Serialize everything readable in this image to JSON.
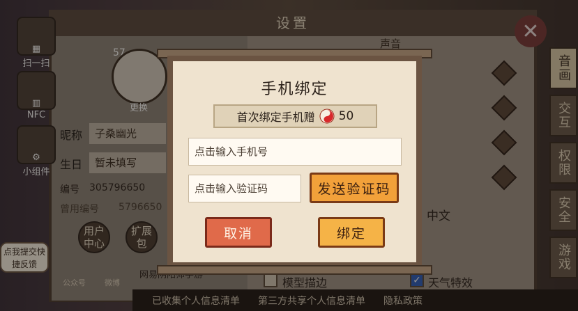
{
  "settings": {
    "title": "设置",
    "sound_label": "声音",
    "language_value": "中文",
    "model_outline_label": "模型描边",
    "weather_effect_label": "天气特效",
    "weather_effect_checked": true,
    "model_outline_checked": false
  },
  "left_sidebar": {
    "items": [
      {
        "label": "扫一扫"
      },
      {
        "label": "NFC"
      },
      {
        "label": "小组件"
      }
    ]
  },
  "profile": {
    "level": "57",
    "change_label": "更换",
    "nickname_label": "昵称",
    "nickname_value": "子桑幽光",
    "birthday_label": "生日",
    "birthday_value": "暂未填写",
    "id_label": "编号",
    "id_value": "305796650",
    "old_id_label": "曾用编号",
    "old_id_value": "5796650",
    "user_center_label": "用户中心",
    "expand_label": "扩展包",
    "wechat_label": "公众号",
    "weibo_label": "微博",
    "game_label": "网易阴阳师手游"
  },
  "right_tabs": [
    {
      "label": "音画",
      "active": true
    },
    {
      "label": "交互",
      "active": false
    },
    {
      "label": "权限",
      "active": false
    },
    {
      "label": "安全",
      "active": false
    },
    {
      "label": "游戏",
      "active": false
    }
  ],
  "feedback": {
    "text": "点我提交快捷反馈"
  },
  "dialog": {
    "title": "手机绑定",
    "reward_text": "首次绑定手机赠",
    "reward_amount": "50",
    "phone_placeholder": "点击输入手机号",
    "code_placeholder": "点击输入验证码",
    "send_code_label": "发送验证码",
    "cancel_label": "取消",
    "confirm_label": "绑定"
  },
  "bottom_links": [
    {
      "label": "已收集个人信息清单"
    },
    {
      "label": "第三方共享个人信息清单"
    },
    {
      "label": "隐私政策"
    }
  ],
  "colors": {
    "dialog_bg": "#efe3cf",
    "send_button": "#f2a13a",
    "cancel_button": "#e06a4a",
    "confirm_button": "#f5b347"
  }
}
